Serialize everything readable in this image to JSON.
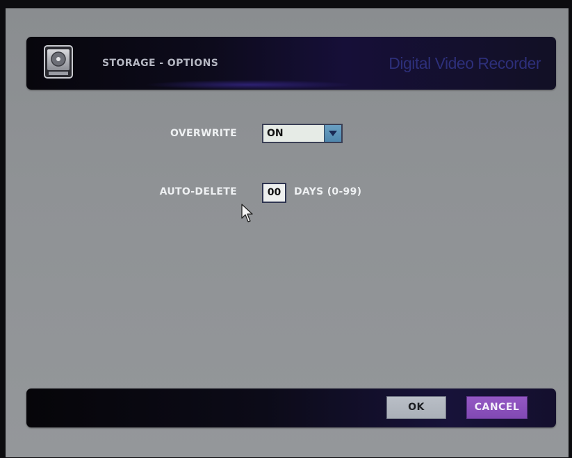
{
  "header": {
    "title": "STORAGE - OPTIONS",
    "brand": "Digital Video Recorder",
    "icon": "hard-disk-icon"
  },
  "settings": {
    "overwrite": {
      "label": "OVERWRITE",
      "value": "ON"
    },
    "auto_delete": {
      "label": "AUTO-DELETE",
      "value": "00",
      "unit": "DAYS (0-99)"
    }
  },
  "footer": {
    "ok_label": "OK",
    "cancel_label": "CANCEL"
  },
  "colors": {
    "screen_background": "#8f9295",
    "header_accent": "#2d2f7a",
    "ok_button": "#b9bec6",
    "cancel_button": "#8f52c0",
    "dropdown_button": "#5c93b8"
  }
}
